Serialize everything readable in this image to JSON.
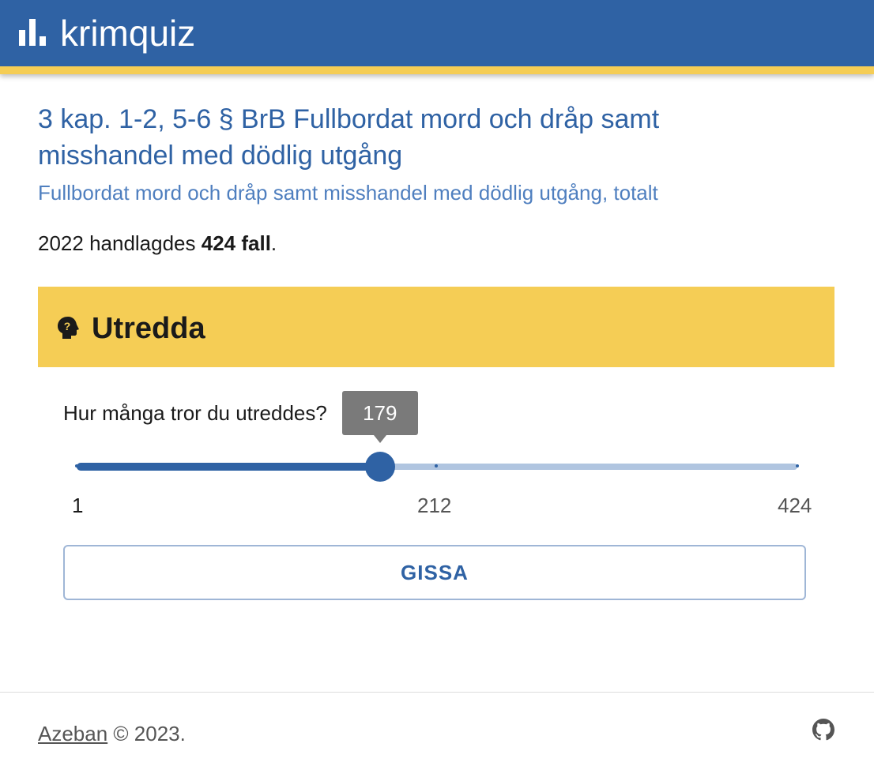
{
  "app": {
    "title": "krimquiz"
  },
  "crime": {
    "title": "3 kap. 1-2, 5-6 § BrB Fullbordat mord och dråp samt misshandel med dödlig utgång",
    "subtitle": "Fullbordat mord och dråp samt misshandel med dödlig utgång, totalt",
    "cases_prefix": "2022 handlagdes ",
    "cases_value": "424 fall",
    "cases_suffix": "."
  },
  "section": {
    "icon": "head-question-icon",
    "title": "Utredda",
    "question": "Hur många tror du utreddes?"
  },
  "slider": {
    "min": 1,
    "max": 424,
    "value": 179,
    "value_label": "179",
    "tick_labels": [
      "1",
      "212",
      "424"
    ],
    "marks": [
      1,
      212,
      424
    ]
  },
  "guess_button": {
    "label": "GISSA"
  },
  "footer": {
    "author": "Azeban",
    "copyright": " © 2023.",
    "icon": "github-icon"
  },
  "colors": {
    "primary": "#2f62a4",
    "accent": "#f5cd55",
    "track": "#b0c5e0",
    "tooltip": "#7a7a7a"
  }
}
